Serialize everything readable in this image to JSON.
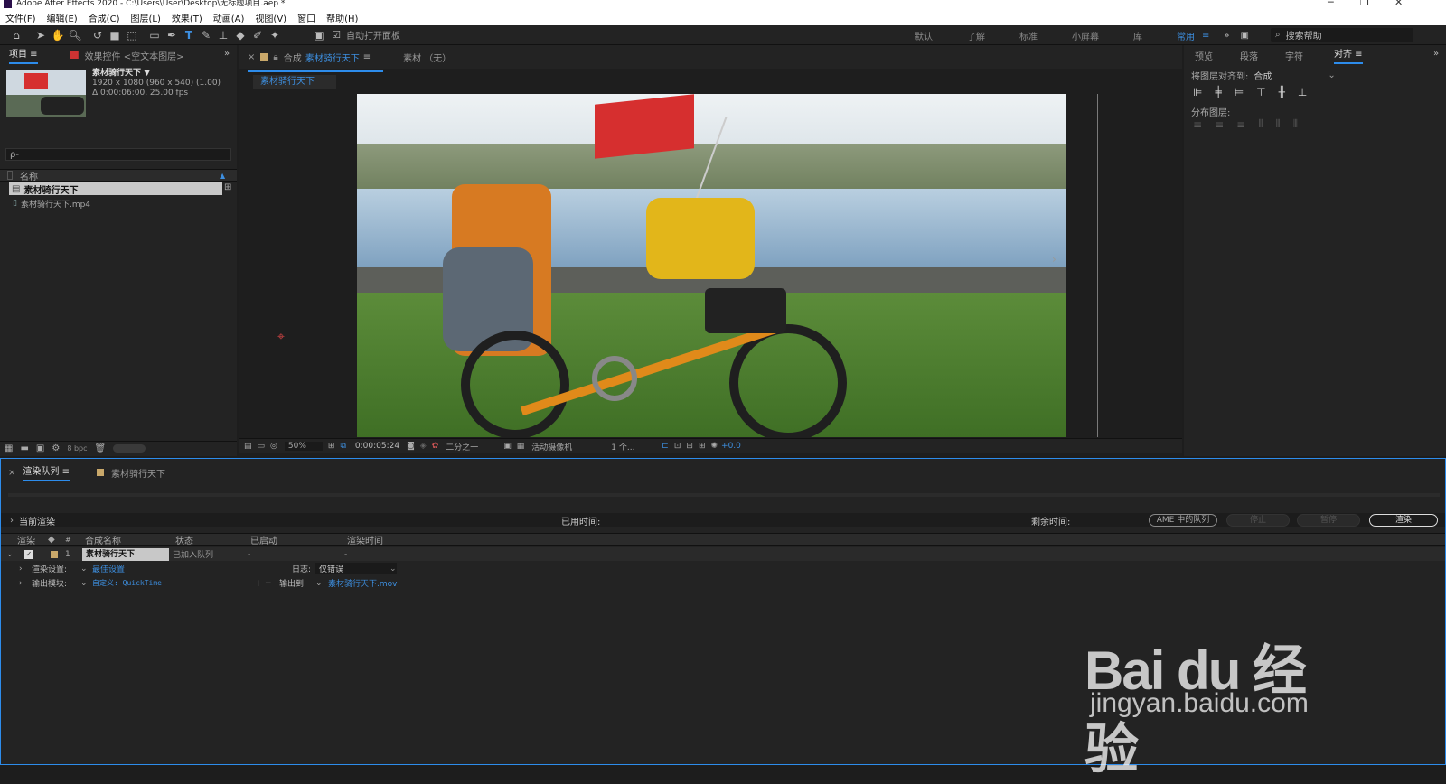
{
  "window": {
    "title": "Adobe After Effects 2020 - C:\\Users\\User\\Desktop\\无标题项目.aep *"
  },
  "menu": [
    "文件(F)",
    "编辑(E)",
    "合成(C)",
    "图层(L)",
    "效果(T)",
    "动画(A)",
    "视图(V)",
    "窗口",
    "帮助(H)"
  ],
  "toolbar": {
    "auto_open_label": "自动打开面板",
    "workspaces": [
      "默认",
      "了解",
      "标准",
      "小屏幕",
      "库"
    ],
    "active_workspace": "常用",
    "search_placeholder": "搜索帮助"
  },
  "project_panel": {
    "tab_project": "项目",
    "tab_effects": "效果控件 <空文本图层>",
    "selected_name": "素材骑行天下 ▼",
    "selected_info_1": "1920 x 1080  (960 x 540) (1.00)",
    "selected_info_2": "Δ 0:00:06:00, 25.00 fps",
    "search_glyph": "ρ-",
    "column_name": "名称",
    "items": [
      {
        "name": "素材骑行天下",
        "type": "comp"
      },
      {
        "name": "素材骑行天下.mp4",
        "type": "file"
      }
    ],
    "bpc": "8 bpc"
  },
  "comp_panel": {
    "tab_prefix": "合成",
    "tab_name": "素材骑行天下",
    "footage_tab": "素材 （无）",
    "subtab": "素材骑行天下",
    "zoom": "50%",
    "timecode": "0:00:05:24",
    "resolution": "二分之一",
    "camera": "活动摄像机",
    "views": "1 个...",
    "exposure": "+0.0"
  },
  "right_panel": {
    "tabs": [
      "预览",
      "段落",
      "字符",
      "对齐"
    ],
    "align_to_label": "将图层对齐到:",
    "align_to_value": "合成",
    "distribute_label": "分布图层:"
  },
  "render_queue": {
    "tab_label": "渲染队列",
    "comp_tab": "素材骑行天下",
    "current_render": "当前渲染",
    "elapsed_label": "已用时间:",
    "remaining_label": "剩余时间:",
    "ame_button": "AME 中的队列",
    "stop_button": "停止",
    "pause_button": "暂停",
    "render_button": "渲染",
    "columns": {
      "render": "渲染",
      "num": "#",
      "comp_name": "合成名称",
      "status": "状态",
      "started": "已启动",
      "render_time": "渲染时间"
    },
    "item": {
      "num": "1",
      "comp_name": "素材骑行天下",
      "status": "已加入队列",
      "started": "-",
      "render_time": "-"
    },
    "render_settings_label": "渲染设置:",
    "render_settings_value": "最佳设置",
    "log_label": "日志:",
    "log_value": "仅错误",
    "output_module_label": "输出模块:",
    "output_module_value": "自定义: QuickTime",
    "output_to_label": "输出到:",
    "output_to_value": "素材骑行天下.mov"
  },
  "watermark": {
    "brand": "Bai du 经验",
    "url": "jingyan.baidu.com"
  },
  "colors": {
    "accent_blue": "#2d8ceb",
    "panel": "#232323",
    "comp_label": "#c9a86a",
    "flag_red": "#d62f2f"
  }
}
